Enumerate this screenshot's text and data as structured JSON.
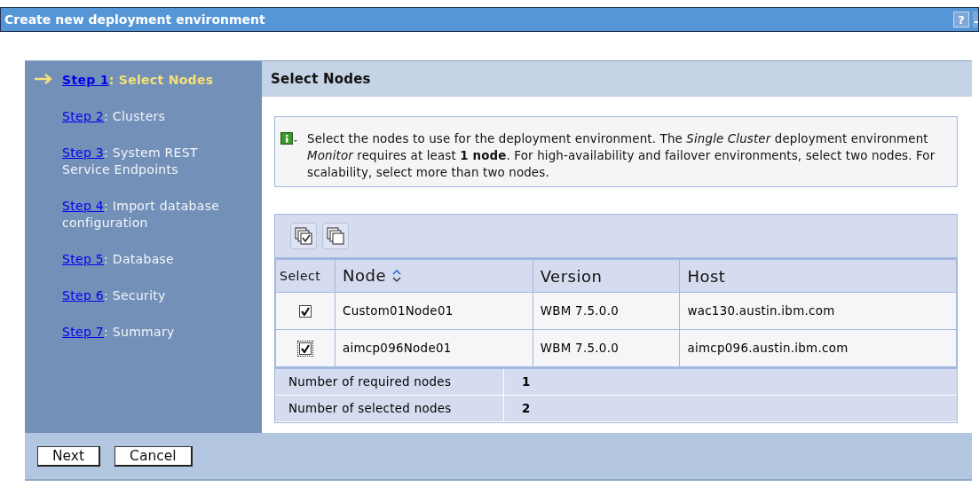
{
  "window": {
    "title": "Create new deployment environment",
    "controls": [
      {
        "kind": "help",
        "label": "?"
      },
      {
        "kind": "minimize"
      }
    ]
  },
  "steps": [
    {
      "link": "Step 1",
      "label": ": Select Nodes",
      "selected": true
    },
    {
      "link": "Step 2",
      "label": ": Clusters",
      "selected": false
    },
    {
      "link": "Step 3",
      "label": ": System REST Service Endpoints",
      "selected": false
    },
    {
      "link": "Step 4",
      "label": ": Import database configuration",
      "selected": false
    },
    {
      "link": "Step 5",
      "label": ": Database",
      "selected": false
    },
    {
      "link": "Step 6",
      "label": ": Security",
      "selected": false
    },
    {
      "link": "Step 7",
      "label": ": Summary",
      "selected": false
    }
  ],
  "panel": {
    "title": "Select Nodes",
    "info": "Select the nodes to use for the deployment environment. The *Single Cluster* deployment environment *Monitor* requires at least **1 node**.  For high-availability and failover environments, select two nodes. For scalability, select more than two nodes.",
    "table": {
      "toolbar": [
        {
          "kind": "select-all"
        },
        {
          "kind": "deselect-all"
        }
      ],
      "columns": [
        {
          "label": "Select"
        },
        {
          "label": "Node",
          "sortable": true
        },
        {
          "label": "Version"
        },
        {
          "label": "Host"
        }
      ],
      "rows": [
        {
          "checked": true,
          "focused": false,
          "node": "Custom01Node01",
          "version": "WBM 7.5.0.0",
          "host": "wac130.austin.ibm.com"
        },
        {
          "checked": true,
          "focused": true,
          "node": "aimcp096Node01",
          "version": "WBM 7.5.0.0",
          "host": "aimcp096.austin.ibm.com"
        }
      ],
      "summary": [
        {
          "label": "Number of required nodes",
          "value": "1"
        },
        {
          "label": "Number of selected nodes",
          "value": "2"
        }
      ]
    }
  },
  "buttons": [
    "Next",
    "Cancel"
  ]
}
